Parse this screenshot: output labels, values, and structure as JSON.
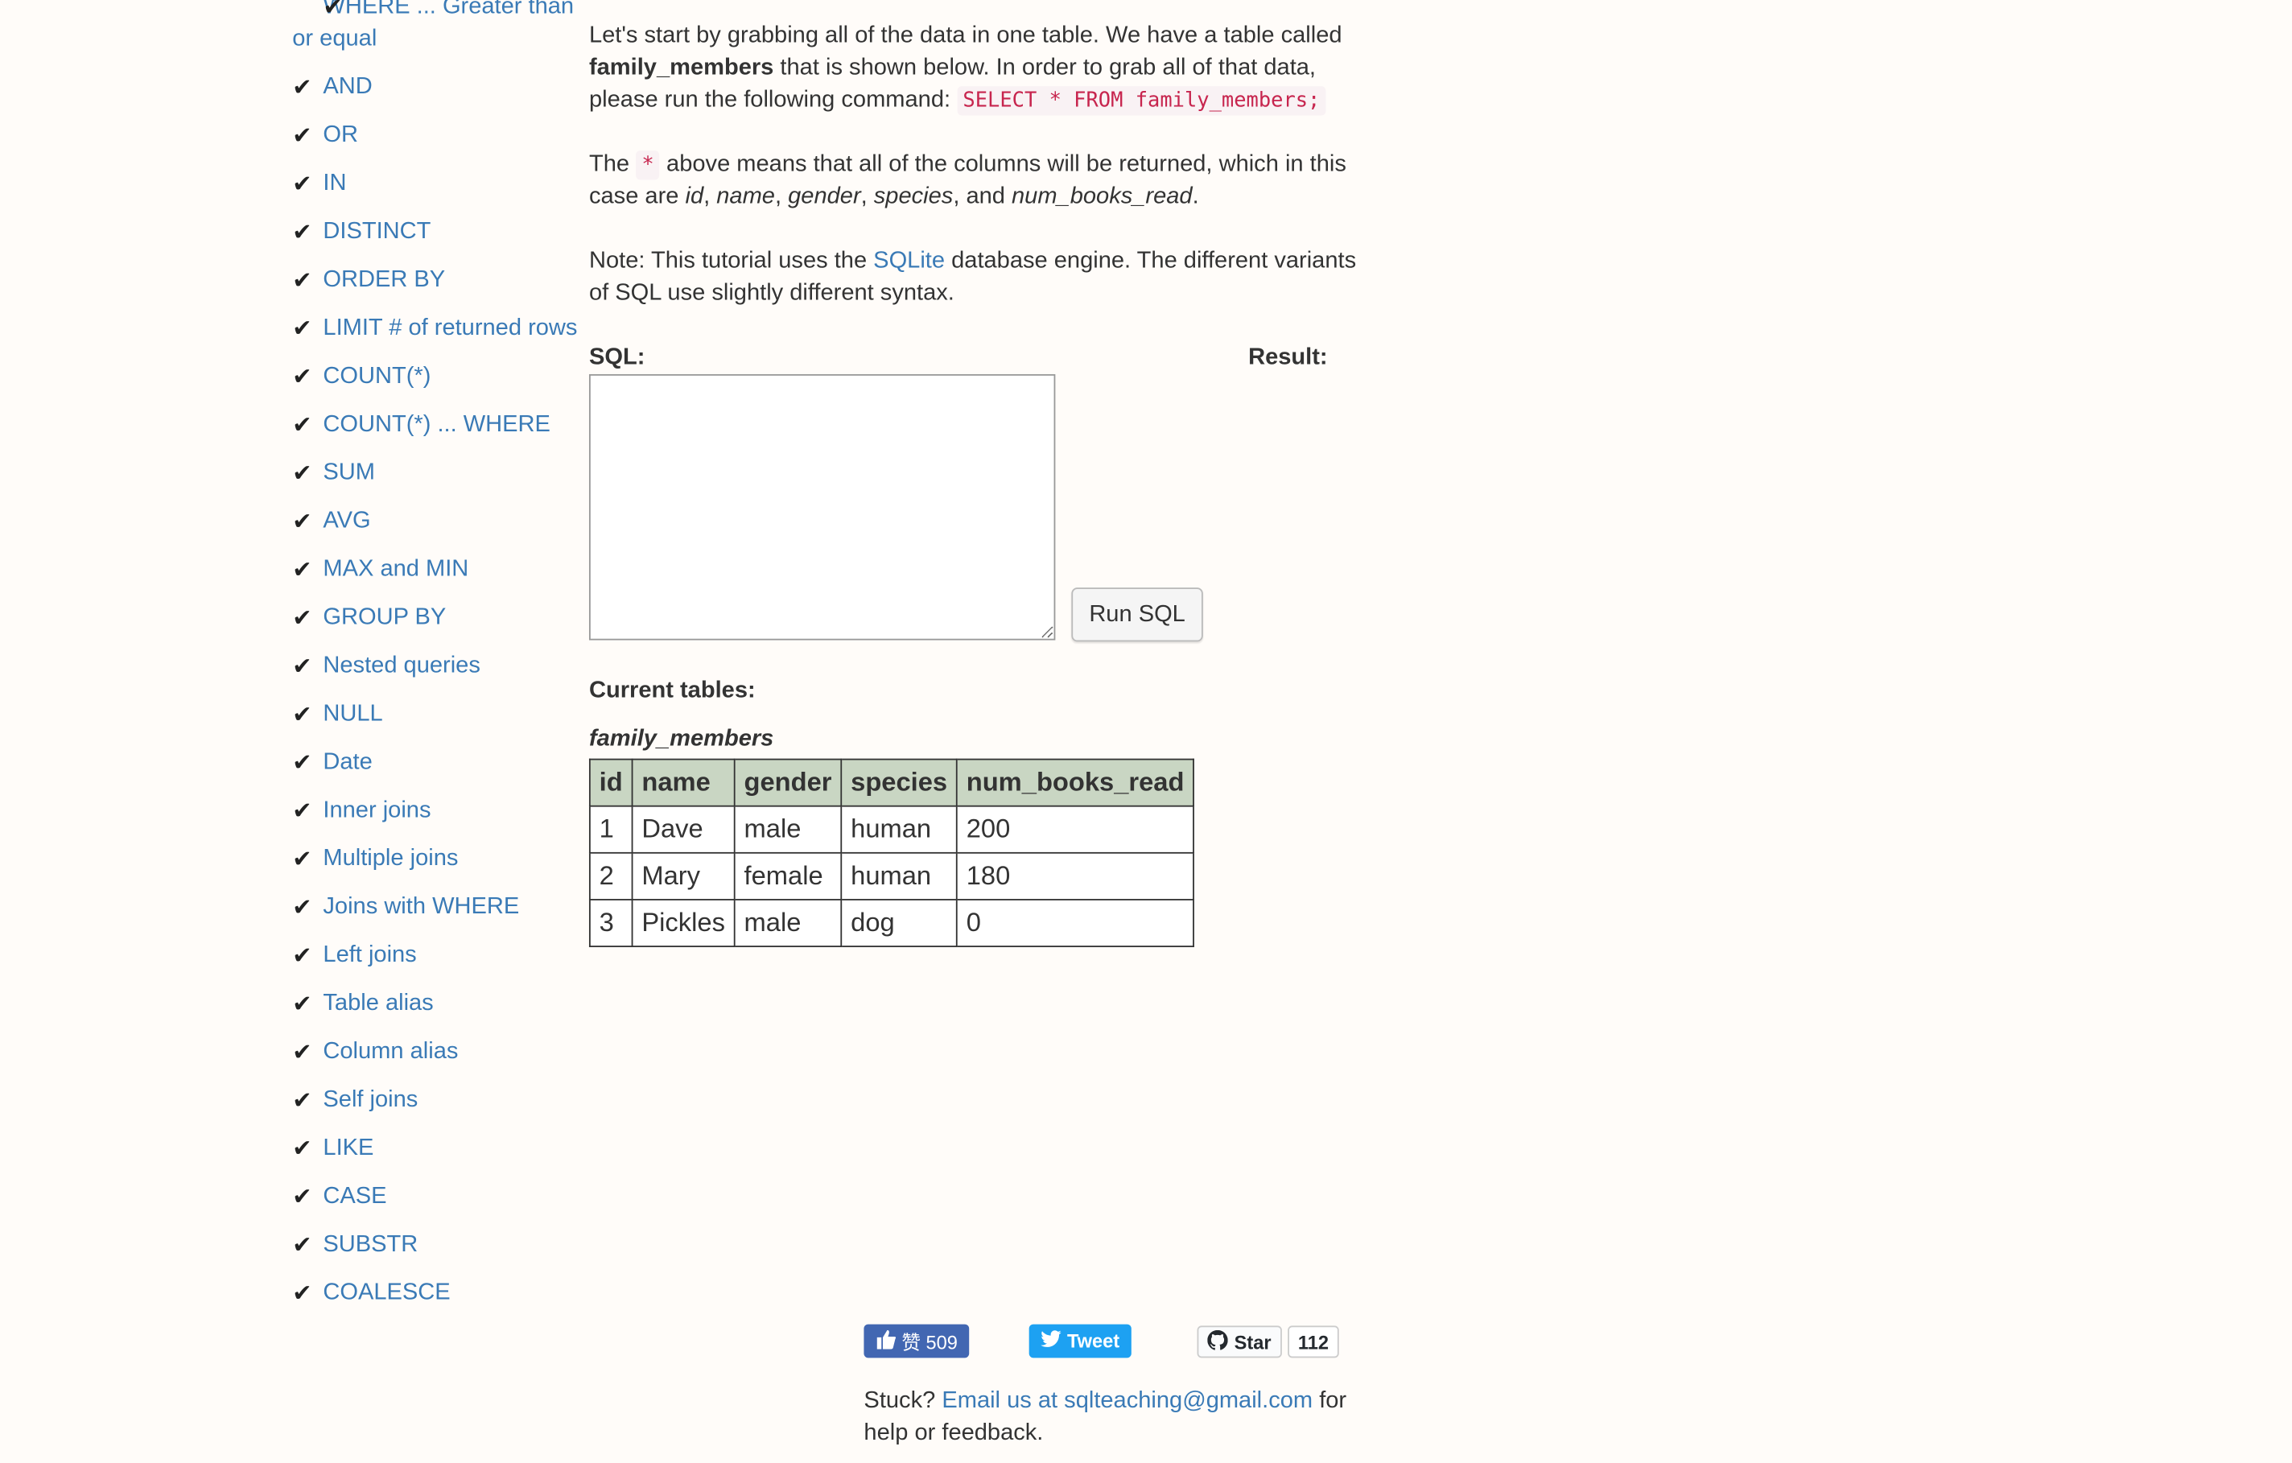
{
  "sidebar": {
    "items": [
      {
        "label": "WHERE ... Greater than or equal"
      },
      {
        "label": "AND"
      },
      {
        "label": "OR"
      },
      {
        "label": "IN"
      },
      {
        "label": "DISTINCT"
      },
      {
        "label": "ORDER BY"
      },
      {
        "label": "LIMIT # of returned rows"
      },
      {
        "label": "COUNT(*)"
      },
      {
        "label": "COUNT(*) ... WHERE"
      },
      {
        "label": "SUM"
      },
      {
        "label": "AVG"
      },
      {
        "label": "MAX and MIN"
      },
      {
        "label": "GROUP BY"
      },
      {
        "label": "Nested queries"
      },
      {
        "label": "NULL"
      },
      {
        "label": "Date"
      },
      {
        "label": "Inner joins"
      },
      {
        "label": "Multiple joins"
      },
      {
        "label": "Joins with WHERE"
      },
      {
        "label": "Left joins"
      },
      {
        "label": "Table alias"
      },
      {
        "label": "Column alias"
      },
      {
        "label": "Self joins"
      },
      {
        "label": "LIKE"
      },
      {
        "label": "CASE"
      },
      {
        "label": "SUBSTR"
      },
      {
        "label": "COALESCE"
      }
    ]
  },
  "intro": {
    "p1_a": "Let's start by grabbing all of the data in one table. We have a table called ",
    "p1_bold": "family_members",
    "p1_b": " that is shown below. In order to grab all of that data, please run the following command: ",
    "p1_code": "SELECT * FROM family_members;",
    "p2_a": "The ",
    "p2_code": "*",
    "p2_b": " above means that all of the columns will be returned, which in this case are ",
    "p2_cols": [
      "id",
      "name",
      "gender",
      "species",
      "num_books_read"
    ],
    "p3_a": "Note: This tutorial uses the ",
    "p3_link": "SQLite",
    "p3_b": " database engine. The different variants of SQL use slightly different syntax."
  },
  "editor": {
    "sql_label": "SQL:",
    "result_label": "Result:",
    "run_label": "Run SQL",
    "sql_value": ""
  },
  "tables": {
    "title": "Current tables:",
    "table_name": "family_members",
    "headers": [
      "id",
      "name",
      "gender",
      "species",
      "num_books_read"
    ],
    "rows": [
      [
        "1",
        "Dave",
        "male",
        "human",
        "200"
      ],
      [
        "2",
        "Mary",
        "female",
        "human",
        "180"
      ],
      [
        "3",
        "Pickles",
        "male",
        "dog",
        "0"
      ]
    ]
  },
  "social": {
    "like_text": "赞 509",
    "tweet_text": "Tweet",
    "star_text": "Star",
    "star_count": "112"
  },
  "footer": {
    "a": "Stuck? ",
    "link": "Email us at sqlteaching@gmail.com",
    "b": " for help or feedback."
  },
  "colors": {
    "link": "#3a7ab6",
    "table_header": "#c9d6c3",
    "code": "#c7254e"
  }
}
